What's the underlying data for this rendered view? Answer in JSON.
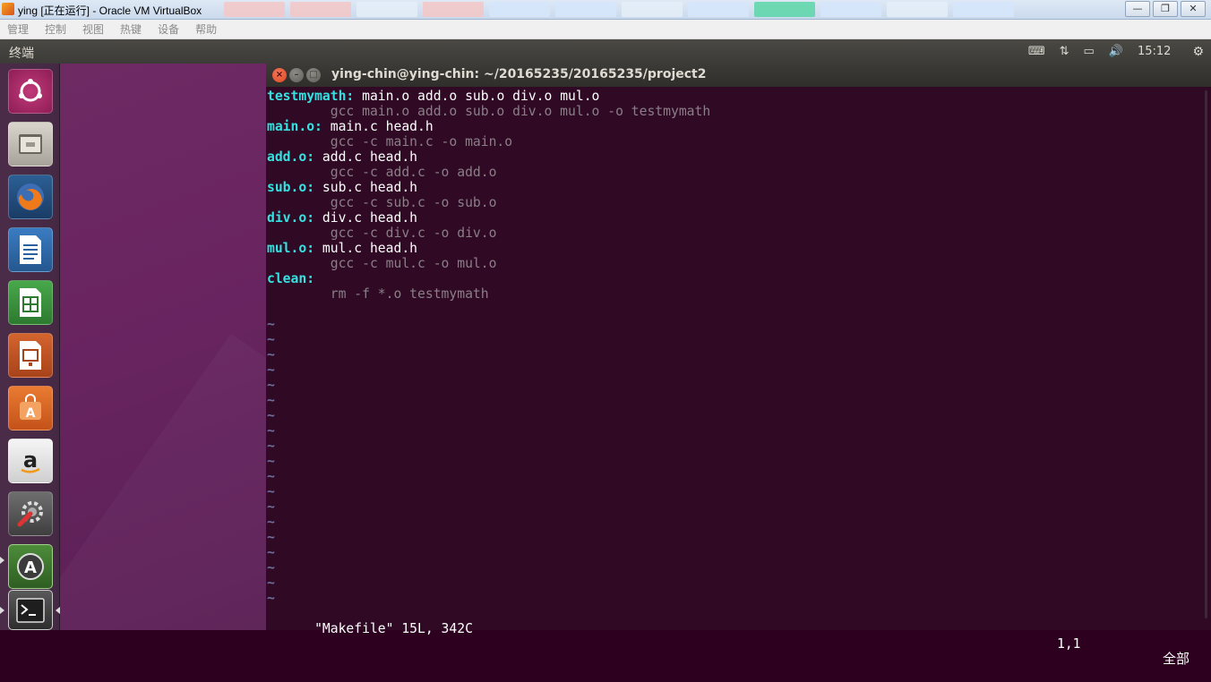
{
  "host": {
    "title": "ying [正在运行] - Oracle VM VirtualBox",
    "controls": {
      "minimize": "—",
      "restore": "❐",
      "close": "✕"
    }
  },
  "vbox_menu": [
    "管理",
    "控制",
    "视图",
    "热键",
    "设备",
    "帮助"
  ],
  "panel": {
    "app_name": "终端",
    "clock": "15:12",
    "icons": [
      "keyboard-icon",
      "network-icon",
      "battery-icon",
      "volume-icon",
      "gear-icon"
    ]
  },
  "launcher": {
    "items": [
      "dash-home",
      "files",
      "firefox",
      "libreoffice-writer",
      "libreoffice-calc",
      "libreoffice-impress",
      "ubuntu-software-center",
      "amazon",
      "system-settings",
      "software-updater",
      "terminal"
    ]
  },
  "terminal": {
    "title": "ying-chin@ying-chin: ~/20165235/20165235/project2",
    "lines": [
      {
        "target": "testmymath:",
        "deps": " main.o add.o sub.o div.o mul.o"
      },
      {
        "cmd": "        gcc main.o add.o sub.o div.o mul.o -o testmymath"
      },
      {
        "target": "main.o:",
        "deps": " main.c head.h"
      },
      {
        "cmd": "        gcc -c main.c -o main.o"
      },
      {
        "target": "add.o:",
        "deps": " add.c head.h"
      },
      {
        "cmd": "        gcc -c add.c -o add.o"
      },
      {
        "target": "sub.o:",
        "deps": " sub.c head.h"
      },
      {
        "cmd": "        gcc -c sub.c -o sub.o"
      },
      {
        "target": "div.o:",
        "deps": " div.c head.h"
      },
      {
        "cmd": "        gcc -c div.c -o div.o"
      },
      {
        "target": "mul.o:",
        "deps": " mul.c head.h"
      },
      {
        "cmd": "        gcc -c mul.c -o mul.o"
      },
      {
        "target": "clean:",
        "deps": ""
      },
      {
        "cmd": "        rm -f *.o testmymath"
      },
      {
        "cmd": ""
      }
    ],
    "tilde": "~",
    "tilde_count": 19,
    "status_message": "\"Makefile\" 15L, 342C",
    "cursor_position": "1,1",
    "view_position": "全部"
  }
}
